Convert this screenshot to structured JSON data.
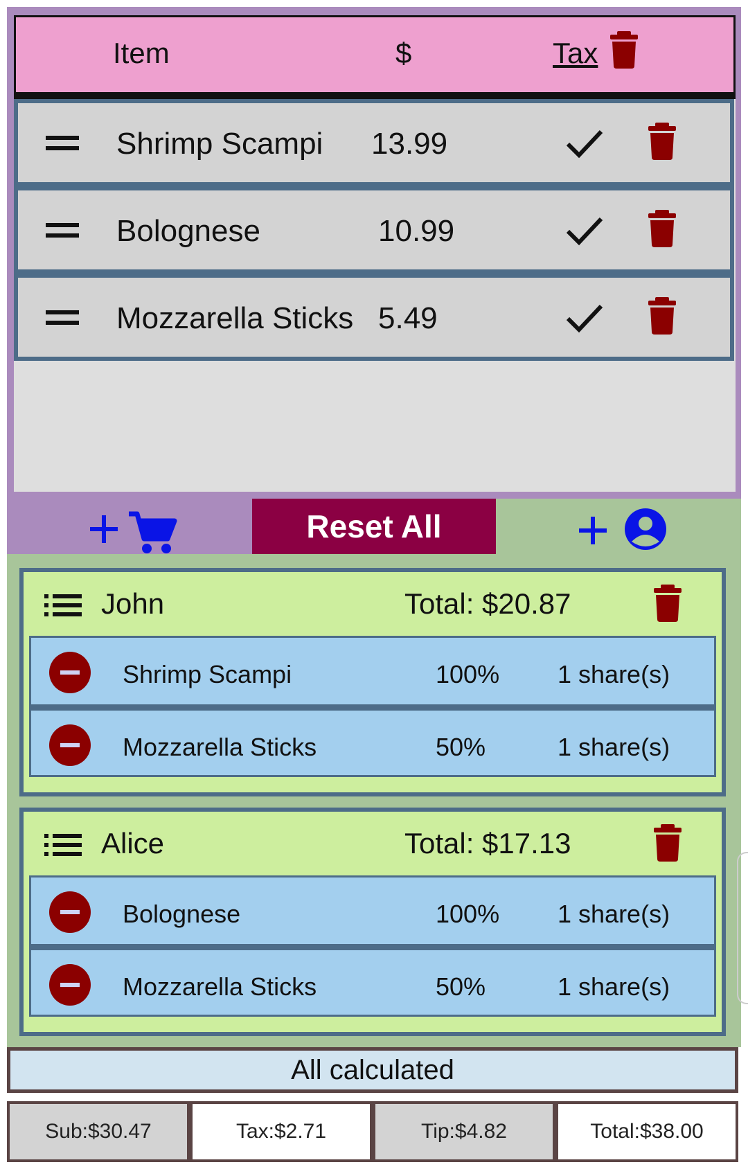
{
  "colors": {
    "items_panel_bg": "#aa8bbd",
    "header_bg": "#eea0cf",
    "row_bg": "#d3d3d3",
    "row_border": "#4d6c88",
    "trash": "#8b0000",
    "accent_blue": "#0a14e6",
    "reset_bg": "#8b0043",
    "people_panel_bg": "#a8c59a",
    "person_card_bg": "#cdee9e",
    "assignment_bg": "#a3cfee",
    "status_bg": "#d2e4f0"
  },
  "items_header": {
    "item_label": "Item",
    "price_label": "$",
    "tax_label": "Tax",
    "delete_icon": "trash-icon"
  },
  "items": [
    {
      "name": "Shrimp Scampi",
      "price": "13.99",
      "taxed": true
    },
    {
      "name": "Bolognese",
      "price": "10.99",
      "taxed": true
    },
    {
      "name": "Mozzarella Sticks",
      "price": "5.49",
      "taxed": true
    }
  ],
  "actions": {
    "add_item_icon": "add-to-cart-icon",
    "reset_label": "Reset All",
    "add_person_icon": "add-person-icon"
  },
  "people": [
    {
      "name": "John",
      "total": "Total: $20.87",
      "assignments": [
        {
          "item": "Shrimp Scampi",
          "percent": "100%",
          "shares": "1 share(s)"
        },
        {
          "item": "Mozzarella Sticks",
          "percent": "50%",
          "shares": "1 share(s)"
        }
      ]
    },
    {
      "name": "Alice",
      "total": "Total: $17.13",
      "assignments": [
        {
          "item": "Bolognese",
          "percent": "100%",
          "shares": "1 share(s)"
        },
        {
          "item": "Mozzarella Sticks",
          "percent": "50%",
          "shares": "1 share(s)"
        }
      ]
    }
  ],
  "status": "All calculated",
  "totals": {
    "sub": "Sub:$30.47",
    "tax": "Tax:$2.71",
    "tip": "Tip:$4.82",
    "total": "Total:$38.00"
  }
}
